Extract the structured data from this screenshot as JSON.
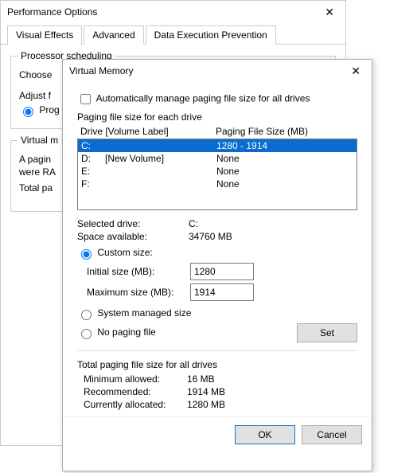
{
  "perf": {
    "title": "Performance Options",
    "tabs": [
      "Visual Effects",
      "Advanced",
      "Data Execution Prevention"
    ],
    "active_tab": 1,
    "proc_group": "Processor scheduling",
    "choose": "Choose",
    "adjust": "Adjust f",
    "programs": "Prog",
    "vm_group": "Virtual m",
    "vm_desc1": "A pagin",
    "vm_desc2": "were RA",
    "vm_total": "Total pa"
  },
  "vm": {
    "title": "Virtual Memory",
    "auto_manage": "Automatically manage paging file size for all drives",
    "pf_each": "Paging file size for each drive",
    "hdr_drive": "Drive  [Volume Label]",
    "hdr_size": "Paging File Size (MB)",
    "drives": [
      {
        "d": "C:",
        "label": "",
        "size": "1280 - 1914",
        "sel": true
      },
      {
        "d": "D:",
        "label": "[New Volume]",
        "size": "None",
        "sel": false
      },
      {
        "d": "E:",
        "label": "",
        "size": "None",
        "sel": false
      },
      {
        "d": "F:",
        "label": "",
        "size": "None",
        "sel": false
      }
    ],
    "sel_drive_k": "Selected drive:",
    "sel_drive_v": "C:",
    "space_k": "Space available:",
    "space_v": "34760 MB",
    "custom": "Custom size:",
    "init_k": "Initial size (MB):",
    "init_v": "1280",
    "max_k": "Maximum size (MB):",
    "max_v": "1914",
    "sys_managed": "System managed size",
    "no_pf": "No paging file",
    "set": "Set",
    "totals_title": "Total paging file size for all drives",
    "min_k": "Minimum allowed:",
    "min_v": "16 MB",
    "rec_k": "Recommended:",
    "rec_v": "1914 MB",
    "cur_k": "Currently allocated:",
    "cur_v": "1280 MB",
    "ok": "OK",
    "cancel": "Cancel"
  }
}
